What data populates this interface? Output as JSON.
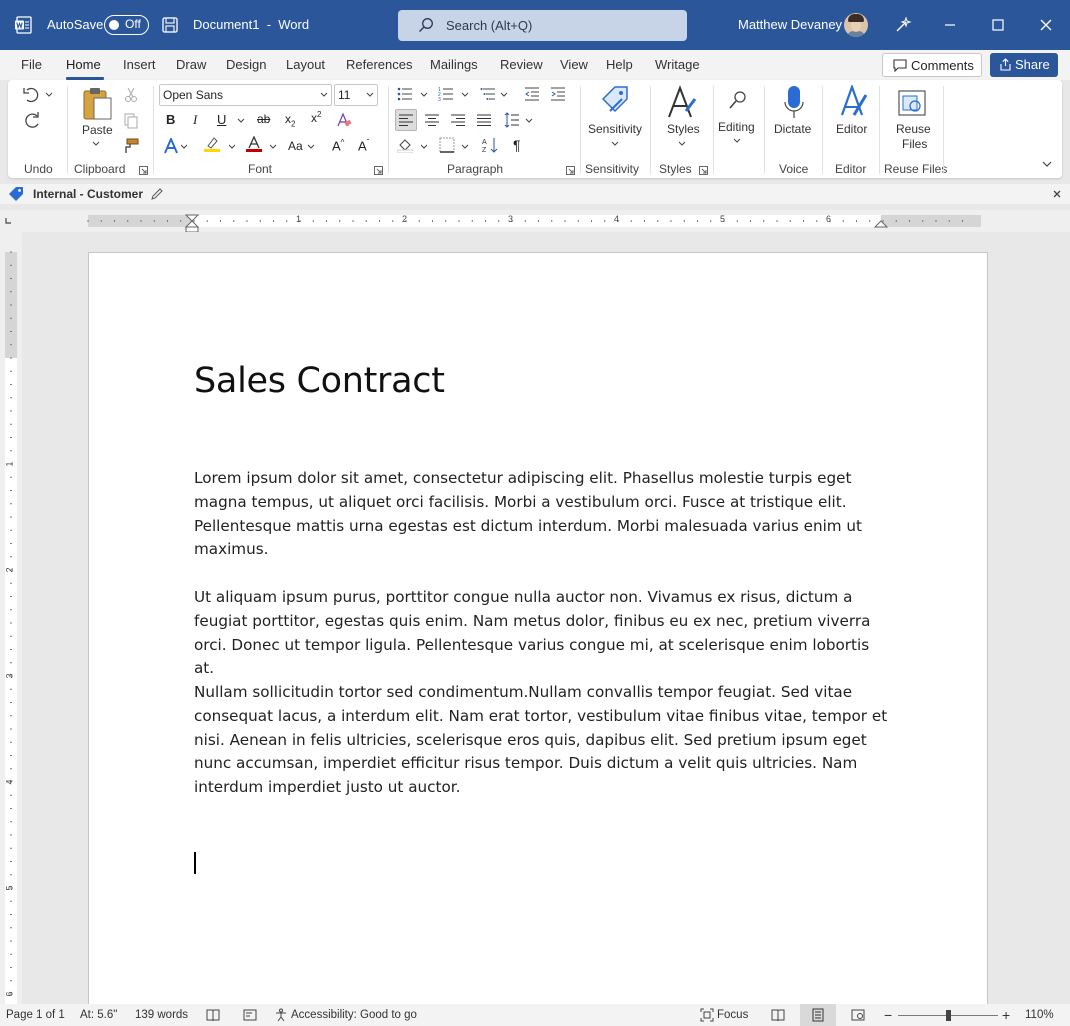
{
  "titlebar": {
    "autosave_label": "AutoSave",
    "autosave_state": "Off",
    "document_title": "Document1  -  Word",
    "search_placeholder": "Search (Alt+Q)",
    "user_name": "Matthew Devaney"
  },
  "tabs": [
    "File",
    "Home",
    "Insert",
    "Draw",
    "Design",
    "Layout",
    "References",
    "Mailings",
    "Review",
    "View",
    "Help",
    "Writage"
  ],
  "active_tab": "Home",
  "actions": {
    "comments": "Comments",
    "share": "Share"
  },
  "ribbon": {
    "undo_group": "Undo",
    "clipboard": {
      "paste": "Paste",
      "group": "Clipboard"
    },
    "font": {
      "family": "Open Sans",
      "size": "11",
      "group": "Font"
    },
    "paragraph": {
      "group": "Paragraph"
    },
    "sensitivity": {
      "button": "Sensitivity",
      "group": "Sensitivity"
    },
    "styles": {
      "button": "Styles",
      "group": "Styles"
    },
    "editing": {
      "button": "Editing"
    },
    "voice": {
      "button": "Dictate",
      "group": "Voice"
    },
    "editor": {
      "button": "Editor",
      "group": "Editor"
    },
    "reuse": {
      "button_line1": "Reuse",
      "button_line2": "Files",
      "group": "Reuse Files"
    }
  },
  "sensitivity_bar": {
    "label": "Internal - Customer"
  },
  "ruler": {
    "h_numbers": [
      "1",
      "2",
      "3",
      "4",
      "5",
      "6"
    ],
    "v_numbers": [
      "1",
      "2",
      "3",
      "4",
      "5",
      "6"
    ]
  },
  "document": {
    "title": "Sales Contract",
    "paragraphs": [
      "Lorem ipsum dolor sit amet, consectetur adipiscing elit. Phasellus molestie turpis eget magna tempus, ut aliquet orci facilisis. Morbi a vestibulum orci. Fusce at tristique elit. Pellentesque mattis urna egestas est dictum interdum. Morbi malesuada varius enim ut maximus.",
      "Ut aliquam ipsum purus, porttitor congue nulla auctor non. Vivamus ex risus, dictum a feugiat porttitor, egestas quis enim. Nam metus dolor, finibus eu ex nec, pretium viverra orci. Donec ut tempor ligula. Pellentesque varius congue mi, at scelerisque enim lobortis at.",
      "Nullam sollicitudin tortor sed condimentum.Nullam convallis tempor feugiat. Sed vitae consequat lacus, a interdum elit. Nam erat tortor, vestibulum vitae finibus vitae, tempor et nisi. Aenean in felis ultricies, scelerisque eros quis, dapibus elit. Sed pretium ipsum eget nunc accumsan, imperdiet efficitur risus tempor. Duis dictum a velit quis ultricies. Nam interdum imperdiet justo ut auctor."
    ]
  },
  "statusbar": {
    "page": "Page 1 of 1",
    "position": "At: 5.6\"",
    "words": "139 words",
    "accessibility": "Accessibility: Good to go",
    "focus": "Focus",
    "zoom": "110%"
  },
  "colors": {
    "accent": "#2b579a",
    "font_color_bar": "#c00000",
    "highlight_bar": "#ffd800"
  }
}
